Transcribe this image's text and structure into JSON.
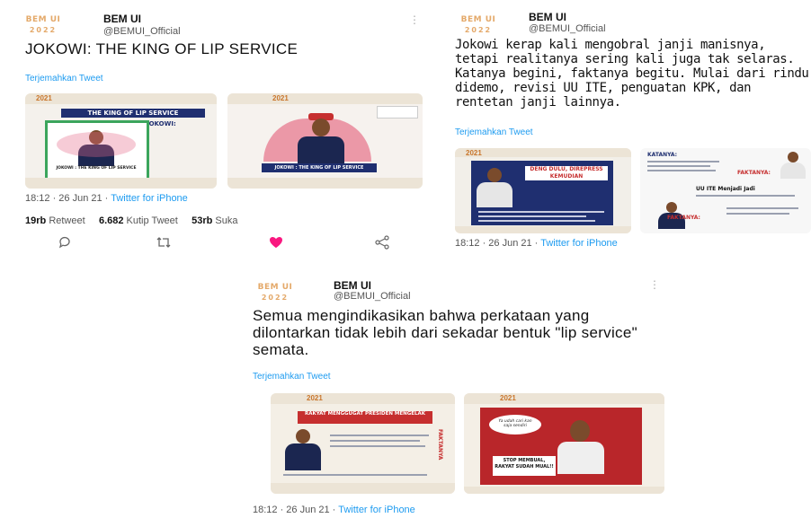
{
  "tweets": [
    {
      "logo": {
        "line1": "BEM UI",
        "line2": "2022"
      },
      "name": "BEM UI",
      "handle": "@BEMUI_Official",
      "text": "JOKOWI: THE KING OF LIP SERVICE",
      "translate": "Terjemahkan Tweet",
      "meta": {
        "time": "18:12 · 26 Jun 21",
        "sep": " · ",
        "source": "Twitter for iPhone"
      },
      "images": [
        {
          "year": "2021",
          "title": "THE KING OF LIP SERVICE",
          "subtitle": "JOKOWI:",
          "caption": "JOKOWI : THE KING OF LIP SERVICE"
        },
        {
          "year": "2021",
          "caption": "JOKOWI : THE KING OF LIP SERVICE"
        }
      ],
      "stats": {
        "retweets": "19rb",
        "retweets_label": "Retweet",
        "quotes": "6.682",
        "quotes_label": "Kutip Tweet",
        "likes": "53rb",
        "likes_label": "Suka"
      }
    },
    {
      "logo": {
        "line1": "BEM UI",
        "line2": "2022"
      },
      "name": "BEM UI",
      "handle": "@BEMUI_Official",
      "text": "Jokowi kerap kali mengobral janji manisnya, tetapi realitanya sering kali juga tak selaras. Katanya begini, faktanya begitu. Mulai dari rindu didemo, revisi UU ITE, penguatan KPK, dan rentetan janji lainnya.",
      "translate": "Terjemahkan Tweet",
      "meta": {
        "time": "18:12 · 26 Jun 21",
        "sep": " · ",
        "source": "Twitter for iPhone"
      },
      "images": [
        {
          "year": "2021",
          "caption": "DENG DULU, DIREPRESS KEMUDIAN"
        },
        {
          "heading1": "KATANYA:",
          "heading2": "FAKTANYA:",
          "heading3": "UU ITE Menjadi Jadi",
          "heading4": "FAKTANYA:"
        }
      ]
    },
    {
      "logo": {
        "line1": "BEM UI",
        "line2": "2022"
      },
      "name": "BEM UI",
      "handle": "@BEMUI_Official",
      "text": "Semua mengindikasikan bahwa perkataan yang dilontarkan tidak lebih dari sekadar bentuk \"lip service\" semata.",
      "translate": "Terjemahkan Tweet",
      "meta": {
        "time": "18:12 · 26 Jun 21",
        "sep": " · ",
        "source": "Twitter for iPhone"
      },
      "images": [
        {
          "year": "2021",
          "caption": "RAKYAT MENGGUGAT PRESIDEN MENGELAK",
          "side": "FAKTANYA"
        },
        {
          "year": "2021",
          "bubble": "Ya udah cari kan saja sendiri",
          "caption": "STOP MEMBUAL, RAKYAT SUDAH MUAL!!"
        }
      ]
    }
  ],
  "colors": {
    "accent": "#1d9bf0",
    "like": "#f91880",
    "logo": "#e4a96a",
    "bem_red": "#c62f2f",
    "bem_blue": "#1f2f70"
  },
  "icons": {
    "reply": "reply-icon",
    "retweet": "retweet-icon",
    "like": "heart-icon",
    "share": "share-icon",
    "more": "more-icon"
  }
}
